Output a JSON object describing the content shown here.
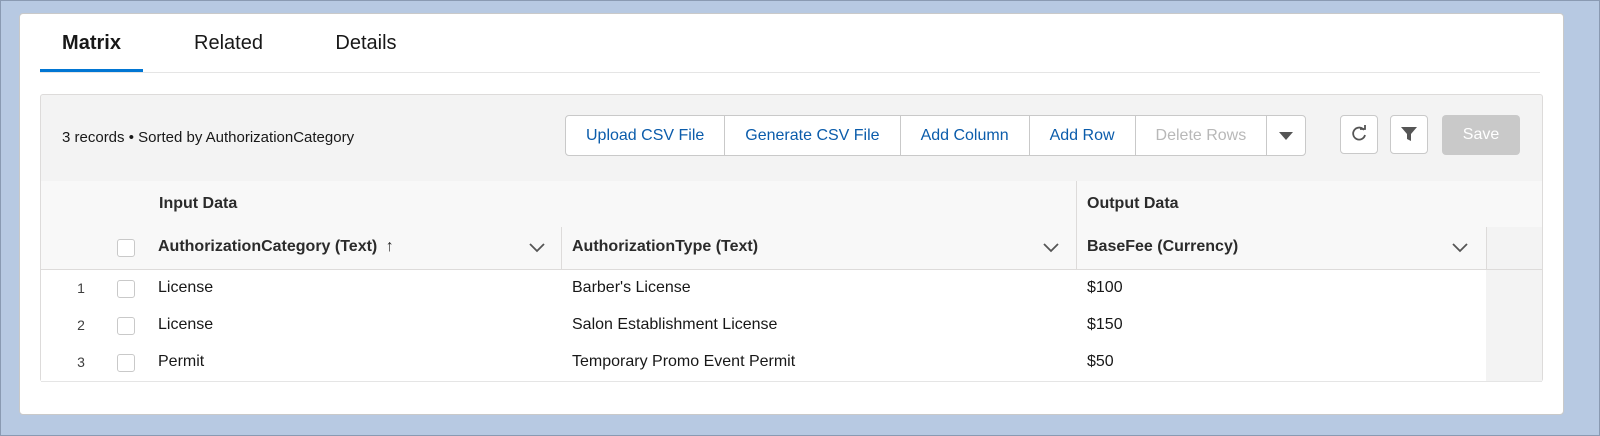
{
  "tabs": [
    {
      "label": "Matrix",
      "active": true
    },
    {
      "label": "Related",
      "active": false
    },
    {
      "label": "Details",
      "active": false
    }
  ],
  "toolbar": {
    "records_info": "3 records • Sorted by AuthorizationCategory",
    "buttons": [
      {
        "label": "Upload CSV File",
        "enabled": true
      },
      {
        "label": "Generate CSV File",
        "enabled": true
      },
      {
        "label": "Add Column",
        "enabled": true
      },
      {
        "label": "Add Row",
        "enabled": true
      },
      {
        "label": "Delete Rows",
        "enabled": false
      }
    ],
    "more_icon": "chevron-down-icon",
    "refresh_icon": "refresh-icon",
    "filter_icon": "filter-icon",
    "save_label": "Save"
  },
  "grid": {
    "groups": {
      "input": "Input Data",
      "output": "Output Data"
    },
    "columns": [
      {
        "title": "AuthorizationCategory (Text)",
        "sorted": "↑"
      },
      {
        "title": "AuthorizationType (Text)"
      },
      {
        "title": "BaseFee (Currency)"
      }
    ],
    "rows": [
      {
        "num": "1",
        "category": "License",
        "type": "Barber's License",
        "fee": "$100"
      },
      {
        "num": "2",
        "category": "License",
        "type": "Salon Establishment License",
        "fee": "$150"
      },
      {
        "num": "3",
        "category": "Permit",
        "type": "Temporary Promo Event Permit",
        "fee": "$50"
      }
    ]
  },
  "colors": {
    "accent": "#0176d3",
    "link": "#0b5cab",
    "disabled": "#c9c9c9"
  }
}
